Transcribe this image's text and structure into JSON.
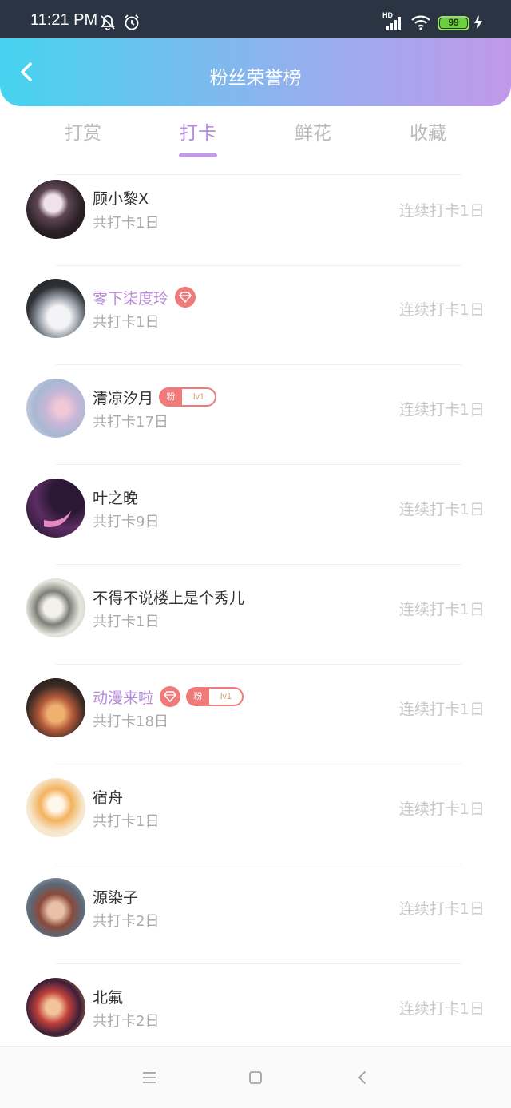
{
  "status_bar": {
    "time": "11:21 PM",
    "network": "HD",
    "battery": "99",
    "battery_fill": 0.99,
    "icons": [
      "bell-off-icon",
      "alarm-icon",
      "signal-icon",
      "wifi-icon",
      "battery-icon",
      "charging-icon"
    ]
  },
  "header": {
    "title": "粉丝荣誉榜",
    "back_icon": "chevron-left-icon",
    "gradient": [
      "#45d3f0",
      "#c198ea"
    ]
  },
  "tabs": [
    {
      "label": "打赏",
      "active": false
    },
    {
      "label": "打卡",
      "active": true
    },
    {
      "label": "鲜花",
      "active": false
    },
    {
      "label": "收藏",
      "active": false
    }
  ],
  "accent_color": "#b48be0",
  "fans": [
    {
      "name": "顾小黎X",
      "total": "共打卡1日",
      "streak": "连续打卡1日",
      "vip": false,
      "gem": false,
      "fan_badge": null
    },
    {
      "name": "零下柒度玲",
      "total": "共打卡1日",
      "streak": "连续打卡1日",
      "vip": true,
      "gem": true,
      "fan_badge": null
    },
    {
      "name": "清凉汐月",
      "total": "共打卡17日",
      "streak": "连续打卡1日",
      "vip": false,
      "gem": false,
      "fan_badge": {
        "label": "粉",
        "level": "lv1"
      }
    },
    {
      "name": "叶之晚",
      "total": "共打卡9日",
      "streak": "连续打卡1日",
      "vip": false,
      "gem": false,
      "fan_badge": null
    },
    {
      "name": "不得不说楼上是个秀儿",
      "total": "共打卡1日",
      "streak": "连续打卡1日",
      "vip": false,
      "gem": false,
      "fan_badge": null
    },
    {
      "name": "动漫来啦",
      "total": "共打卡18日",
      "streak": "连续打卡1日",
      "vip": true,
      "gem": true,
      "fan_badge": {
        "label": "粉",
        "level": "lv1"
      }
    },
    {
      "name": "宿舟",
      "total": "共打卡1日",
      "streak": "连续打卡1日",
      "vip": false,
      "gem": false,
      "fan_badge": null
    },
    {
      "name": "源染子",
      "total": "共打卡2日",
      "streak": "连续打卡1日",
      "vip": false,
      "gem": false,
      "fan_badge": null
    },
    {
      "name": "北氟",
      "total": "共打卡2日",
      "streak": "连续打卡1日",
      "vip": false,
      "gem": false,
      "fan_badge": null
    }
  ],
  "nav_bar": {
    "icons": [
      "menu-icon",
      "home-icon",
      "back-icon"
    ]
  }
}
